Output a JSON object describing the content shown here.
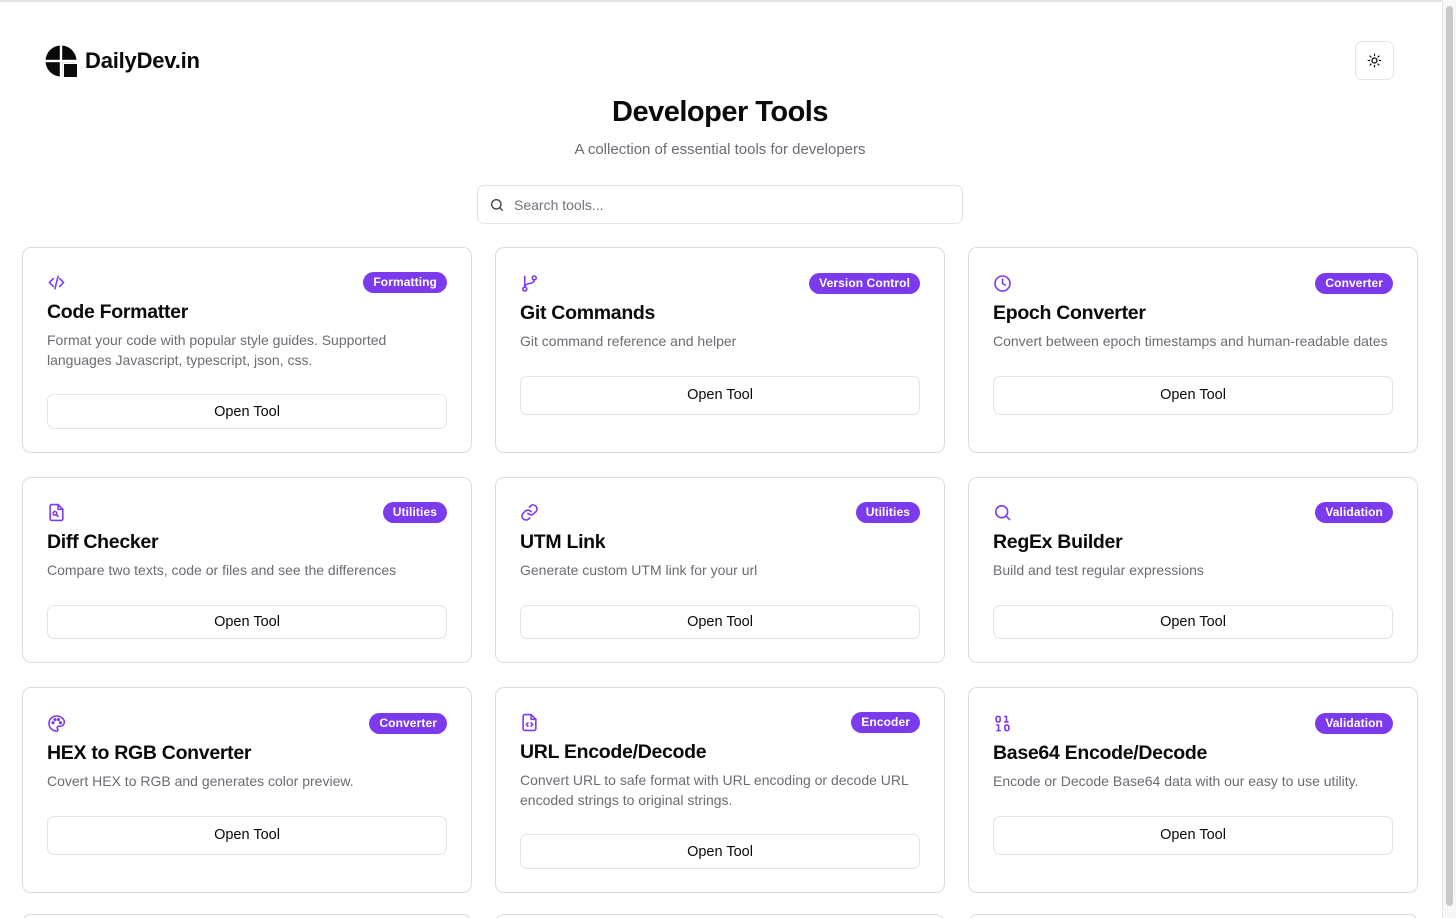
{
  "header": {
    "brand": "DailyDev.in",
    "theme_icon": "sun-icon"
  },
  "main": {
    "title": "Developer Tools",
    "subtitle": "A collection of essential tools for developers",
    "search": {
      "placeholder": "Search tools...",
      "value": "",
      "icon": "search-icon"
    }
  },
  "accent_color": "#7c3aed",
  "tools": [
    {
      "icon": "code-icon",
      "badge": "Formatting",
      "title": "Code Formatter",
      "description": "Format your code with popular style guides. Supported languages Javascript, typescript, json, css.",
      "button": "Open Tool"
    },
    {
      "icon": "git-branch-icon",
      "badge": "Version Control",
      "title": "Git Commands",
      "description": "Git command reference and helper",
      "button": "Open Tool"
    },
    {
      "icon": "clock-icon",
      "badge": "Converter",
      "title": "Epoch Converter",
      "description": "Convert between epoch timestamps and human-readable dates",
      "button": "Open Tool"
    },
    {
      "icon": "file-diff-icon",
      "badge": "Utilities",
      "title": "Diff Checker",
      "description": "Compare two texts, code or files and see the differences",
      "button": "Open Tool"
    },
    {
      "icon": "link-icon",
      "badge": "Utilities",
      "title": "UTM Link",
      "description": "Generate custom UTM link for your url",
      "button": "Open Tool"
    },
    {
      "icon": "search-icon",
      "badge": "Validation",
      "title": "RegEx Builder",
      "description": "Build and test regular expressions",
      "button": "Open Tool"
    },
    {
      "icon": "palette-icon",
      "badge": "Converter",
      "title": "HEX to RGB Converter",
      "description": "Covert HEX to RGB and generates color preview.",
      "button": "Open Tool"
    },
    {
      "icon": "file-code-icon",
      "badge": "Encoder",
      "title": "URL Encode/Decode",
      "description": "Convert URL to safe format with URL encoding or decode URL encoded strings to original strings.",
      "button": "Open Tool"
    },
    {
      "icon": "binary-icon",
      "badge": "Validation",
      "title": "Base64 Encode/Decode",
      "description": "Encode or Decode Base64 data with our easy to use utility.",
      "button": "Open Tool"
    }
  ]
}
